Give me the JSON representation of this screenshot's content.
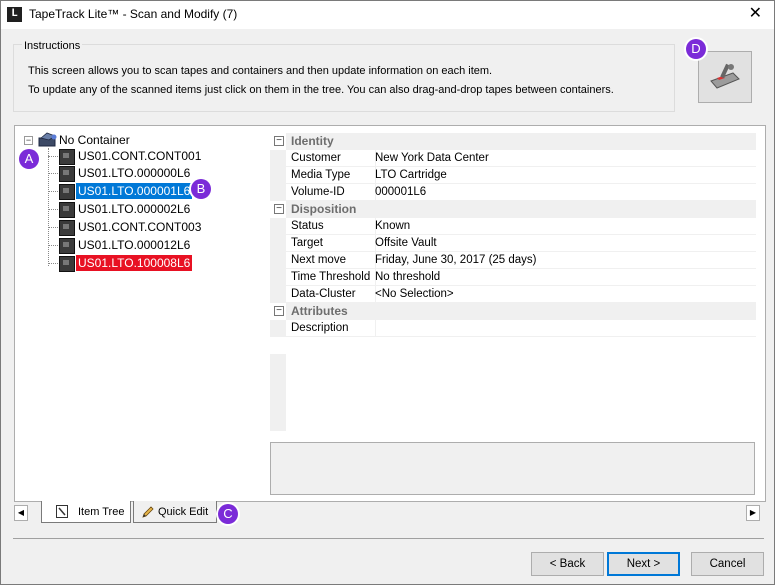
{
  "window": {
    "title": "TapeTrack Lite™ - Scan and Modify (7)",
    "app_icon_glyph": "L",
    "close_glyph": "✕"
  },
  "instructions": {
    "group_title": "Instructions",
    "line1": "This screen allows you to scan tapes and containers and then update information on each item.",
    "line2": "To update any of the scanned items just click on them in the tree. You can also drag-and-drop tapes between containers."
  },
  "scan_button": {
    "icon": "scanner-icon"
  },
  "tree": {
    "root_label": "No Container",
    "expander_glyph": "−",
    "items": [
      {
        "label": "US01.CONT.CONT001",
        "state": "normal"
      },
      {
        "label": "US01.LTO.000000L6",
        "state": "normal"
      },
      {
        "label": "US01.LTO.000001L6",
        "state": "selected"
      },
      {
        "label": "US01.LTO.000002L6",
        "state": "normal"
      },
      {
        "label": "US01.CONT.CONT003",
        "state": "normal"
      },
      {
        "label": "US01.LTO.000012L6",
        "state": "normal"
      },
      {
        "label": "US01.LTO.100008L6",
        "state": "alert"
      }
    ]
  },
  "properties": {
    "collapse_glyph": "−",
    "identity": {
      "label": "Identity",
      "customer": {
        "name": "Customer",
        "value": "New York Data Center"
      },
      "media_type": {
        "name": "Media Type",
        "value": "LTO Cartridge"
      },
      "volume_id": {
        "name": "Volume-ID",
        "value": "000001L6"
      }
    },
    "disposition": {
      "label": "Disposition",
      "status": {
        "name": "Status",
        "value": "Known"
      },
      "target": {
        "name": "Target",
        "value": "Offsite Vault"
      },
      "next_move": {
        "name": "Next move",
        "value": "Friday, June 30, 2017 (25 days)"
      },
      "time_threshold": {
        "name": "Time Threshold",
        "value": "No threshold"
      },
      "data_cluster": {
        "name": "Data-Cluster",
        "value": "<No Selection>"
      }
    },
    "attributes": {
      "label": "Attributes",
      "description": {
        "name": "Description",
        "value": ""
      }
    }
  },
  "tabs": {
    "item_tree": "Item Tree",
    "quick_edit": "Quick Edit",
    "scroll_left_glyph": "◀",
    "scroll_right_glyph": "▶"
  },
  "buttons": {
    "back": "< Back",
    "next": "Next >",
    "cancel": "Cancel"
  },
  "callouts": {
    "a": "A",
    "b": "B",
    "c": "C",
    "d": "D"
  },
  "colors": {
    "selection": "#0078d7",
    "alert": "#e81123",
    "callout": "#7b2bd8"
  }
}
